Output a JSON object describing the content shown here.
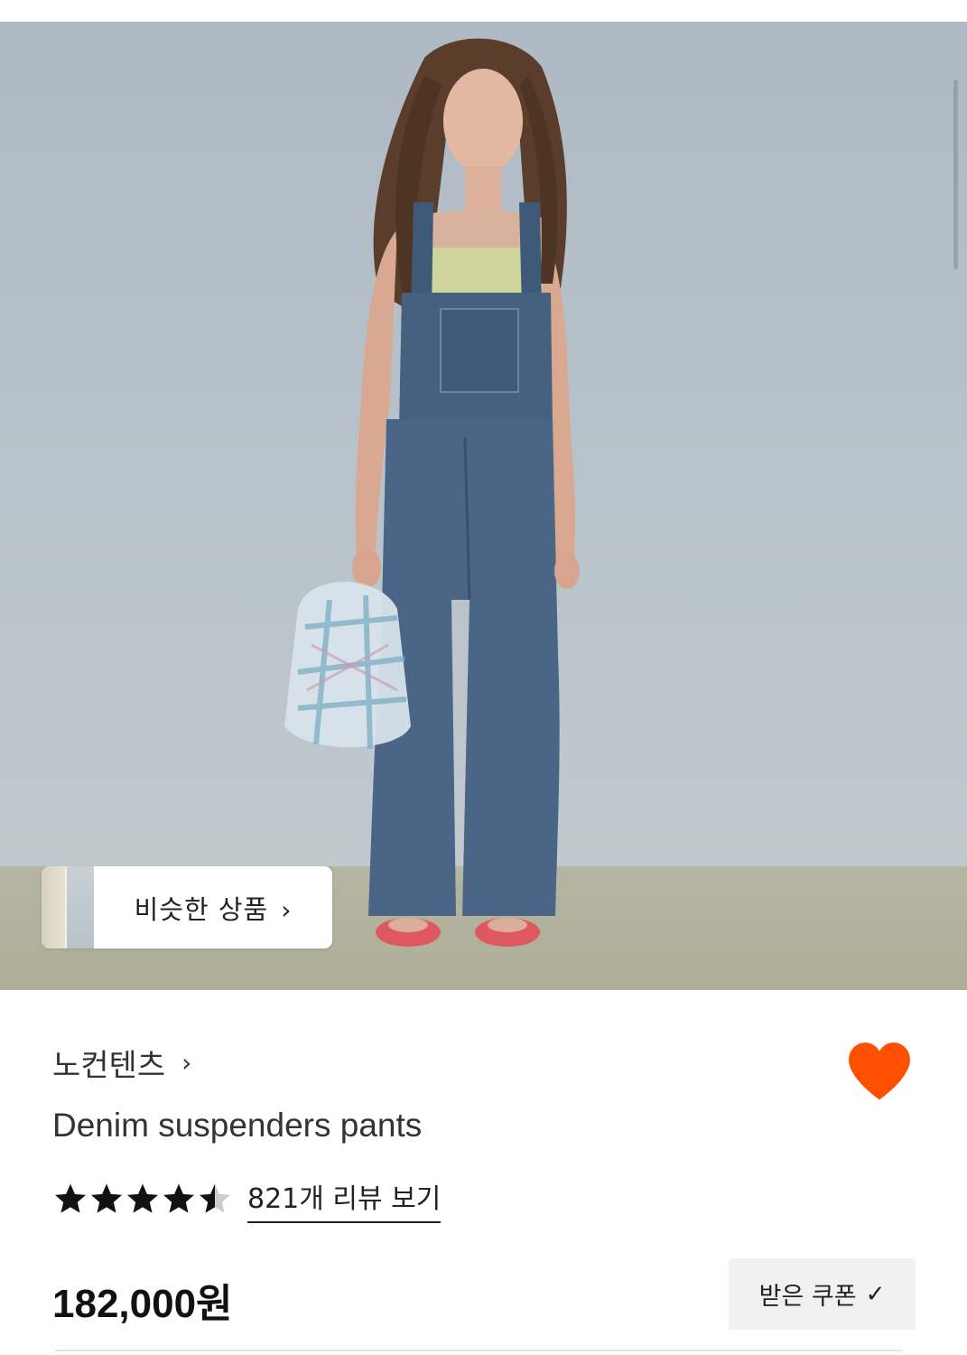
{
  "similar": {
    "label": "비슷한 상품",
    "chevron": "›"
  },
  "brand": {
    "name": "노컨텐츠",
    "chevron": "›"
  },
  "product": {
    "name": "Denim suspenders pants",
    "rating": 4.5,
    "review_link": "821개 리뷰 보기",
    "price": "182,000원"
  },
  "coupon": {
    "label": "받은 쿠폰",
    "check": "✓"
  },
  "colors": {
    "heart": "#fe5000",
    "star": "#111111",
    "star_empty": "#cccccc"
  }
}
